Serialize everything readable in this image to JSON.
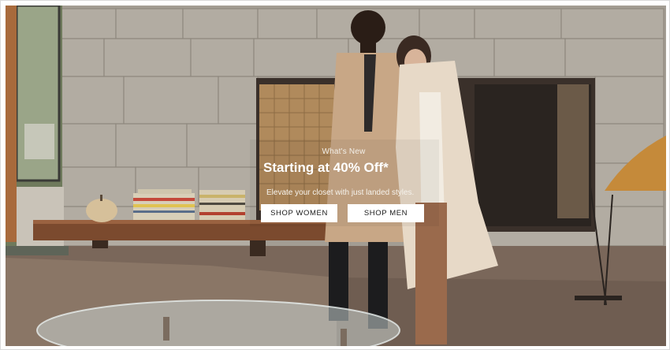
{
  "hero": {
    "eyebrow": "What's New",
    "headline": "Starting at 40% Off*",
    "subline": "Elevate your closet with just landed styles.",
    "buttons": {
      "shop_women": "SHOP WOMEN",
      "shop_men": "SHOP MEN"
    }
  },
  "colors": {
    "stone_wall": "#a9a399",
    "floor": "#7a675a",
    "shelf_wood": "#7b4a2e",
    "men_coat": "#c8a786",
    "women_coat": "#e7d9c7",
    "button_bg": "#ffffff",
    "text_light": "#ffffff"
  }
}
